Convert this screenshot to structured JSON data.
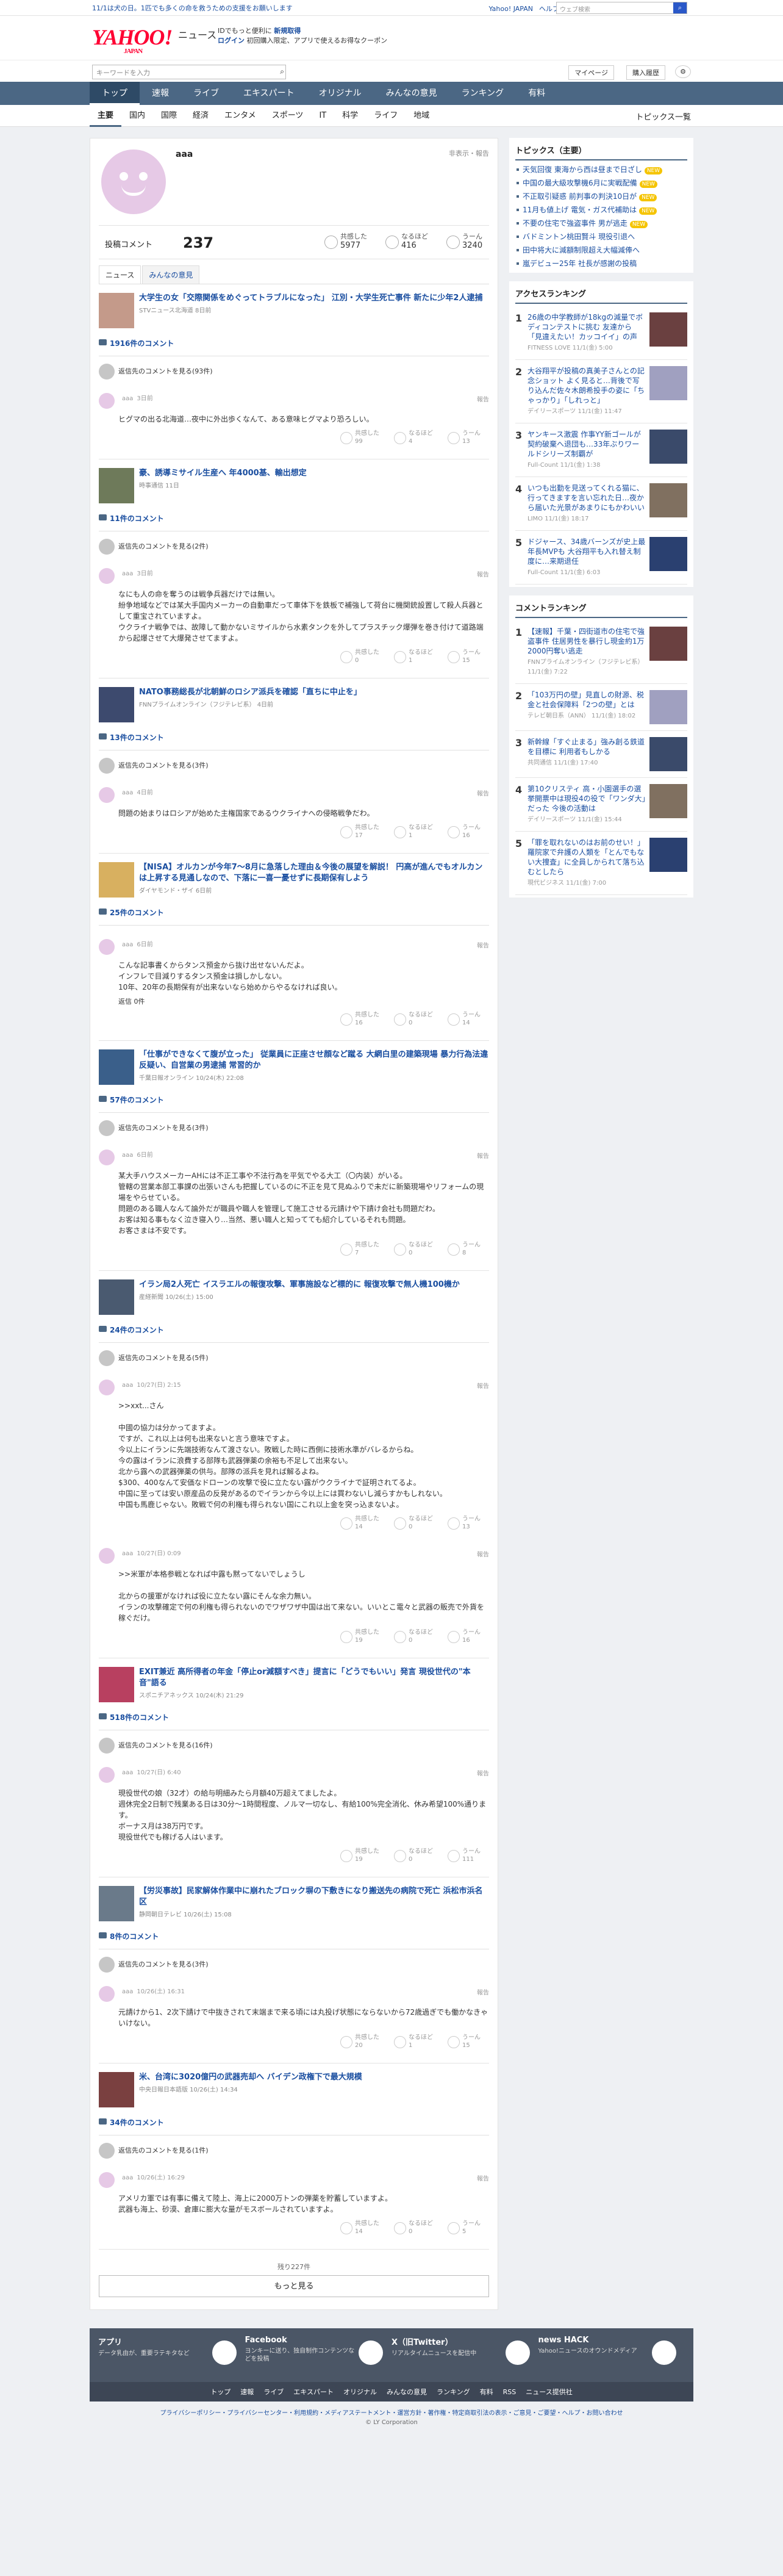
{
  "topbar": {
    "notice": "11/1は犬の日。1匹でも多くの命を救うための支援をお願いします",
    "links": [
      "Yahoo! JAPAN",
      "ヘルプ"
    ],
    "search_placeholder": "ウェブ検索"
  },
  "header": {
    "logo": "YAHOO!",
    "logo_sub": "JAPAN",
    "service": "ニュース",
    "msg1": "IDでもっと便利に",
    "msg1_link": "新規取得",
    "msg2": "ログイン",
    "msg2_rest": "初回購入限定、アプリで使えるお得なクーポン"
  },
  "subbar": {
    "search_placeholder": "キーワードを入力",
    "mypage": "マイページ",
    "purchase": "購入履歴"
  },
  "nav": [
    "トップ",
    "速報",
    "ライブ",
    "エキスパート",
    "オリジナル",
    "みんなの意見",
    "ランキング",
    "有料"
  ],
  "subnav": {
    "items": [
      "主要",
      "国内",
      "国際",
      "経済",
      "エンタメ",
      "スポーツ",
      "IT",
      "科学",
      "ライフ",
      "地域"
    ],
    "right": "トピックス一覧"
  },
  "profile": {
    "name": "aaa",
    "report": "非表示・報告",
    "comments_label": "投稿コメント",
    "comments_count": "237",
    "stats": [
      {
        "label": "共感した",
        "value": "5977"
      },
      {
        "label": "なるほど",
        "value": "416"
      },
      {
        "label": "うーん",
        "value": "3240"
      }
    ]
  },
  "tabs": [
    "ニュース",
    "みんなの意見"
  ],
  "labels": {
    "owner": "返信先のコメントを見る",
    "report": "報告",
    "react1": "共感した",
    "react2": "なるほど",
    "react3": "うーん"
  },
  "articles": [
    {
      "title": "大学生の女「交際関係をめぐってトラブルになった」 江別・大学生死亡事件 新たに少年2人逮捕",
      "src": "STVニュース北海道 8日前",
      "count": "1916件のコメント",
      "owner": "返信先のコメントを見る(93件)",
      "comments": [
        {
          "name": "aaa",
          "time": "3日前",
          "body": "ヒグマの出る北海道…夜中に外出歩くなんて、ある意味ヒグマより恐ろしい。",
          "r": [
            "99",
            "4",
            "13"
          ]
        }
      ]
    },
    {
      "title": "豪、誘導ミサイル生産へ 年4000基、輸出想定",
      "src": "時事通信 11日",
      "count": "11件のコメント",
      "owner": "返信先のコメントを見る(2件)",
      "comments": [
        {
          "name": "aaa",
          "time": "3日前",
          "body": "なにも人の命を奪うのは戦争兵器だけでは無い。\n紛争地域などでは某大手国内メーカーの自動車だって車体下を鉄板で補強して荷台に機関銃設置して殺人兵器として重宝されていますよ。\nウクライナ戦争では、故障して動かないミサイルから水素タンクを外してプラスチック爆弾を巻き付けて道路端から起爆させて大爆発させてますよ。",
          "r": [
            "0",
            "1",
            "15"
          ]
        }
      ]
    },
    {
      "title": "NATO事務総長が北朝鮮のロシア派兵を確認「直ちに中止を」",
      "src": "FNNプライムオンライン（フジテレビ系） 4日前",
      "count": "13件のコメント",
      "owner": "返信先のコメントを見る(3件)",
      "comments": [
        {
          "name": "aaa",
          "time": "4日前",
          "body": "問題の始まりはロシアが始めた主権国家であるウクライナへの侵略戦争だわ。",
          "r": [
            "17",
            "1",
            "16"
          ]
        }
      ]
    },
    {
      "title": "【NISA】オルカンが今年7〜8月に急落した理由＆今後の展望を解説！ 円高が進んでもオルカンは上昇する見通しなので、下落に一喜一憂せずに長期保有しよう",
      "src": "ダイヤモンド・ザイ 6日前",
      "count": "25件のコメント",
      "owner": "",
      "comments": [
        {
          "name": "aaa",
          "time": "6日前",
          "body": "こんな記事書くからタンス預金から抜け出せないんだよ。\nインフレで目減りするタンス預金は損しかしない。\n10年、20年の長期保有が出来ないなら始めからやるなければ良い。",
          "r": [
            "16",
            "0",
            "14"
          ],
          "reply": "返信 0件"
        }
      ]
    },
    {
      "title": "「仕事ができなくて腹が立った」 従業員に正座させ顔など蹴る 大網白里の建築現場 暴力行為法違反疑い、自営業の男逮捕 常習的か",
      "src": "千葉日報オンライン 10/24(木) 22:08",
      "count": "57件のコメント",
      "owner": "返信先のコメントを見る(3件)",
      "comments": [
        {
          "name": "aaa",
          "time": "6日前",
          "body": "某大手ハウスメーカーAHには不正工事や不法行為を平気でやる大工（〇内装）がいる。\n管轄の営業本部工事課の出張いさんも把握しているのに不正を見て見ぬふりで未だに新築現場やリフォームの現場をやらせている。\n問題のある職人なんて論外だが職員や職人を管理して施工させる元請けや下請け会社も問題だわ。\nお客は知る事もなく泣き寝入り…当然、悪い職人と知ってても紹介しているそれも問題。\nお客さまは不安です。",
          "r": [
            "7",
            "0",
            "8"
          ]
        }
      ]
    },
    {
      "title": "イラン局2人死亡 イスラエルの報復攻撃、軍事施設など標的に 報復攻撃で無人機100機か",
      "src": "産経新聞 10/26(土) 15:00",
      "count": "24件のコメント",
      "owner": "返信先のコメントを見る(5件)",
      "comments": [
        {
          "name": "aaa",
          "time": "10/27(日) 2:15",
          "body": ">>xxt...さん\n\n中國の協力は分かってますよ。\nですが、これ以上は何も出来ないと言う意味ですよ。\n今以上にイランに先端技術なんて渡さない。敗戦した時に西側に技術水準がバレるからね。\n今の露はイランに浪費する部隊も武器弾薬の余裕も不足して出来ない。\n北から露への武器弾薬の供与。部隊の派兵を見れば解るよね。\n$300、400なんて安価なドローンの攻撃で役に立たない露がウクライナで証明されてるよ。\n中国に至っては安い原産品の反発があるのでイランから今以上には買わないし減らすかもしれない。\n中国も馬鹿じゃない。敗戦で何の利権も得られない国にこれ以上金を突っ込まないよ。",
          "r": [
            "14",
            "0",
            "13"
          ]
        },
        {
          "name": "aaa",
          "time": "10/27(日) 0:09",
          "body": ">>米軍が本格参戦となれば中露も黙ってないでしょうし\n\n北からの援軍がなければ役に立たない露にそんな余力無い。\nイランの攻撃確定で何の利権も得られないのでワザワザ中国は出て来ない。いいとこ電々と武器の販売で外貨を稼ぐだけ。",
          "r": [
            "19",
            "0",
            "16"
          ]
        }
      ]
    },
    {
      "title": "EXIT兼近 高所得者の年金「停止or減額すべき」提言に「どうでもいい」発言 現役世代の\"本音\"語る",
      "src": "スポニチアネックス 10/24(木) 21:29",
      "count": "518件のコメント",
      "owner": "返信先のコメントを見る(16件)",
      "comments": [
        {
          "name": "aaa",
          "time": "10/27(日) 6:40",
          "body": "現役世代の娘（32才）の給与明細みたら月額40万超えてましたよ。\n週休完全2日制で残業ある日は30分〜1時間程度、ノルマ一切なし、有給100%完全消化、休み希望100%通ります。\nボーナス月は38万円です。\n現役世代でも稼げる人はいます。",
          "r": [
            "19",
            "0",
            "111"
          ]
        }
      ]
    },
    {
      "title": "【労災事故】民家解体作業中に崩れたブロック塀の下敷きになり搬送先の病院で死亡 浜松市浜名区",
      "src": "静岡朝日テレビ 10/26(土) 15:08",
      "count": "8件のコメント",
      "owner": "返信先のコメントを見る(3件)",
      "comments": [
        {
          "name": "aaa",
          "time": "10/26(土) 16:31",
          "body": "元請けから1、2次下請けで中抜きされて末端まで来る頃には丸投げ状態にならないから72歳過ぎでも働かなきゃいけない。",
          "r": [
            "20",
            "1",
            "15"
          ]
        }
      ]
    },
    {
      "title": "米、台湾に3020億円の武器売却へ バイデン政権下で最大規模",
      "src": "中央日報日本語版 10/26(土) 14:34",
      "count": "34件のコメント",
      "owner": "返信先のコメントを見る(1件)",
      "comments": [
        {
          "name": "aaa",
          "time": "10/26(土) 16:29",
          "body": "アメリカ軍では有事に備えて陸上、海上に2000万トンの弾薬を貯蓄していますよ。\n武器も海上、砂漠、倉庫に膨大な量がモスボールされていますよ。",
          "r": [
            "14",
            "0",
            "5"
          ]
        }
      ]
    }
  ],
  "remain": "残り227件",
  "more": "もっと見る",
  "side": {
    "topics_title": "トピックス（主要）",
    "topics": [
      {
        "t": "天気回復 東海から西は昼まで日ざし",
        "b": "NEW"
      },
      {
        "t": "中国の最大級攻撃機6月に実戦配備",
        "b": "NEW"
      },
      {
        "t": "不正取引疑惑 前判事の判決10日が",
        "b": "NEW"
      },
      {
        "t": "11月も値上げ 電気・ガス代補助は",
        "b": "NEW"
      },
      {
        "t": "不要の住宅で強盗事件 男が逃走",
        "b": "NEW"
      },
      {
        "t": "バドミントン桃田賢斗 現役引退へ",
        "b": ""
      },
      {
        "t": "田中将大に減額制限超え大幅減俸へ",
        "b": ""
      },
      {
        "t": "嵐デビュー25年 社長が感謝の投稿",
        "b": ""
      }
    ],
    "access_title": "アクセスランキング",
    "access": [
      {
        "t": "26歳の中学教師が18kgの減量でボディコンテストに挑む 友達から「見違えたい！カッコイイ」の声",
        "s": "FITNESS LOVE 11/1(金) 5:00"
      },
      {
        "t": "大谷翔平が投稿の真美子さんとの記念ショット よく見ると…背後で写り込んだ佐々木朗希投手の姿に「ちゃっかり」「しれっと」",
        "s": "デイリースポーツ 11/1(金) 11:47"
      },
      {
        "t": "ヤンキース激震 作事YY新ゴールが契約破棄へ退団も…33年ぶりワールドシリーズ制覇が",
        "s": "Full-Count 11/1(金) 1:38"
      },
      {
        "t": "いつも出勤を見送ってくれる猫に、行ってきますを言い忘れた日…夜から届いた光景があまりにもかわいい",
        "s": "LIMO 11/1(金) 18:17"
      },
      {
        "t": "ドジャース、34歳バーンズが史上最年長MVPも 大谷翔平も入れ替え制度に…来期退任",
        "s": "Full-Count 11/1(金) 6:03"
      }
    ],
    "comment_title": "コメントランキング",
    "comments": [
      {
        "t": "【速報】千葉・四街道市の住宅で強盗事件 住居男性を暴行し現金約1万2000円奪い逃走",
        "s": "FNNプライムオンライン（フジテレビ系） 11/1(金) 7:22"
      },
      {
        "t": "「103万円の壁」見直しの財源、税金と社会保障料「2つの壁」とは",
        "s": "テレビ朝日系（ANN） 11/1(金) 18:02"
      },
      {
        "t": "新幹線「すぐ止まる」強み創る鉄道を目標に 利用者もしかる",
        "s": "共同通信 11/1(金) 17:40"
      },
      {
        "t": "第10クリスティ 高・小園選手の選挙開票中は現役4の役で「ワンダ大」だった 今後の活動は",
        "s": "デイリースポーツ 11/1(金) 15:44"
      },
      {
        "t": "「罪を取れないのはお前のせい！」 羅院家で弁護の人類を「とんでもない大捜査」に全員しかられて落ち込むとしたら",
        "s": "現代ビジネス 11/1(金) 7:00"
      }
    ]
  },
  "footer": {
    "apps": [
      {
        "t": "アプリ",
        "d": "データ乳由が、重要ラテキタなど"
      },
      {
        "t": "Facebook",
        "d": "ヨンキーに送り、独自制作コンテンツなどを投稿"
      },
      {
        "t": "X（旧Twitter）",
        "d": "リアルタイムニュースを配信中"
      },
      {
        "t": "news HACK",
        "d": "Yahoo!ニュースのオウンドメディア"
      }
    ],
    "links": [
      "トップ",
      "速報",
      "ライブ",
      "エキスパート",
      "オリジナル",
      "みんなの意見",
      "ランキング",
      "有料",
      "RSS",
      "ニュース提供社"
    ],
    "policy": "プライバシーポリシー・プライバシーセンター・利用規約・メディアステートメント・運営方針・著作権・特定商取引法の表示・ご意見・ご要望・ヘルプ・お問い合わせ",
    "copy": "© LY Corporation"
  }
}
